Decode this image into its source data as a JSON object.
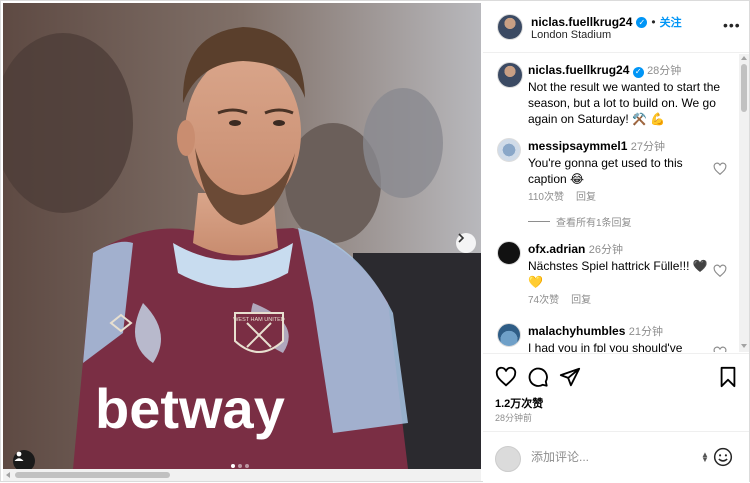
{
  "post": {
    "username": "niclas.fuellkrug24",
    "follow_label": "关注",
    "location": "London Stadium",
    "caption_time": "28分钟",
    "caption_text": "Not the result we wanted to start the season, but a lot to build on. We go again on Saturday! ⚒️ 💪",
    "likes": "1.2万次赞",
    "posted_ago": "28分钟前"
  },
  "image": {
    "shirt_sponsor": "betway",
    "badge_text": "WEST HAM UNITED"
  },
  "comments": [
    {
      "username": "messipsaymmel1",
      "time": "27分钟",
      "text": "You're gonna get used to this caption 😂",
      "likes": "110次赞",
      "reply_label": "回复"
    },
    {
      "username": "ofx.adrian",
      "time": "26分钟",
      "text": "Nächstes Spiel hattrick Fülle!!! 🖤 💛",
      "likes": "74次赞",
      "reply_label": "回复"
    },
    {
      "username": "malachyhumbles",
      "time": "21分钟",
      "text": "I had you in fpl you should've",
      "likes": "",
      "reply_label": ""
    }
  ],
  "view_replies": "查看所有1条回复",
  "composer": {
    "placeholder": "添加评论..."
  },
  "icons": {
    "like": "heart-icon",
    "comment": "comment-icon",
    "share": "send-icon",
    "save": "bookmark-icon",
    "more": "more-icon",
    "emoji": "emoji-icon",
    "verified": "verified-badge-icon"
  },
  "colors": {
    "accent": "#0095f6",
    "muted": "#8e8e8e",
    "shirt_claret": "#7a2e44",
    "shirt_blue": "#a9c7e6"
  }
}
